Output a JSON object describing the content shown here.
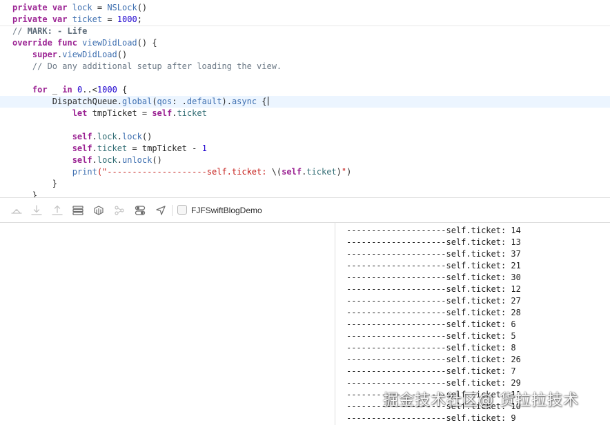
{
  "editor": {
    "lines": [
      [
        {
          "t": "private",
          "c": "kw"
        },
        {
          "t": " "
        },
        {
          "t": "var",
          "c": "kw"
        },
        {
          "t": " "
        },
        {
          "t": "lock",
          "c": "fn"
        },
        {
          "t": " = "
        },
        {
          "t": "NSLock",
          "c": "fn"
        },
        {
          "t": "()"
        }
      ],
      [
        {
          "t": "private",
          "c": "kw"
        },
        {
          "t": " "
        },
        {
          "t": "var",
          "c": "kw"
        },
        {
          "t": " "
        },
        {
          "t": "ticket",
          "c": "fn"
        },
        {
          "t": " = "
        },
        {
          "t": "1000",
          "c": "num"
        },
        {
          "t": ";"
        }
      ],
      [
        {
          "t": "// ",
          "c": "cm"
        },
        {
          "t": "MARK: - Life",
          "c": "cmb"
        }
      ],
      [
        {
          "t": "override",
          "c": "kw"
        },
        {
          "t": " "
        },
        {
          "t": "func",
          "c": "kw"
        },
        {
          "t": " "
        },
        {
          "t": "viewDidLoad",
          "c": "fn"
        },
        {
          "t": "() {"
        }
      ],
      [
        {
          "t": "    "
        },
        {
          "t": "super",
          "c": "kw"
        },
        {
          "t": "."
        },
        {
          "t": "viewDidLoad",
          "c": "fn"
        },
        {
          "t": "()"
        }
      ],
      [
        {
          "t": "    "
        },
        {
          "t": "// Do any additional setup after loading the view.",
          "c": "cm"
        }
      ],
      [],
      [
        {
          "t": "    "
        },
        {
          "t": "for",
          "c": "kw"
        },
        {
          "t": " _ "
        },
        {
          "t": "in",
          "c": "kw"
        },
        {
          "t": " "
        },
        {
          "t": "0",
          "c": "num"
        },
        {
          "t": "..<"
        },
        {
          "t": "1000",
          "c": "num"
        },
        {
          "t": " {"
        }
      ],
      [
        {
          "t": "        DispatchQueue."
        },
        {
          "t": "global",
          "c": "fn"
        },
        {
          "t": "("
        },
        {
          "t": "qos",
          "c": "fn"
        },
        {
          "t": ": ."
        },
        {
          "t": "default",
          "c": "fn"
        },
        {
          "t": ")."
        },
        {
          "t": "async",
          "c": "fn"
        },
        {
          "t": " {"
        },
        {
          "caret": true
        }
      ],
      [
        {
          "t": "            "
        },
        {
          "t": "let",
          "c": "kw"
        },
        {
          "t": " tmpTicket = "
        },
        {
          "t": "self",
          "c": "kw"
        },
        {
          "t": "."
        },
        {
          "t": "ticket",
          "c": "prop"
        }
      ],
      [],
      [
        {
          "t": "            "
        },
        {
          "t": "self",
          "c": "kw"
        },
        {
          "t": "."
        },
        {
          "t": "lock",
          "c": "prop"
        },
        {
          "t": "."
        },
        {
          "t": "lock",
          "c": "fn"
        },
        {
          "t": "()"
        }
      ],
      [
        {
          "t": "            "
        },
        {
          "t": "self",
          "c": "kw"
        },
        {
          "t": "."
        },
        {
          "t": "ticket",
          "c": "prop"
        },
        {
          "t": " = tmpTicket - "
        },
        {
          "t": "1",
          "c": "num"
        }
      ],
      [
        {
          "t": "            "
        },
        {
          "t": "self",
          "c": "kw"
        },
        {
          "t": "."
        },
        {
          "t": "lock",
          "c": "prop"
        },
        {
          "t": "."
        },
        {
          "t": "unlock",
          "c": "fn"
        },
        {
          "t": "()"
        }
      ],
      [
        {
          "t": "            "
        },
        {
          "t": "print",
          "c": "fn"
        },
        {
          "t": "(\"--------------------self.ticket: ",
          "c": "str"
        },
        {
          "t": "\\("
        },
        {
          "t": "self",
          "c": "kw"
        },
        {
          "t": "."
        },
        {
          "t": "ticket",
          "c": "prop"
        },
        {
          "t": ")"
        },
        {
          "t": "\"",
          "c": "str"
        },
        {
          "t": ")"
        }
      ],
      [
        {
          "t": "        }"
        }
      ],
      [
        {
          "t": "    }"
        }
      ]
    ],
    "current_line": 8
  },
  "debug_toolbar": {
    "icons": [
      "hide-debug-area-icon",
      "step-over-icon",
      "step-into-icon",
      "step-out-icon",
      "view-hierarchy-icon",
      "memory-graph-icon",
      "share-icon",
      "environment-overrides-icon",
      "simulate-location-icon"
    ],
    "process_name": "FJFSwiftBlogDemo"
  },
  "console": {
    "lines": [
      "--------------------self.ticket: 14",
      "--------------------self.ticket: 13",
      "--------------------self.ticket: 37",
      "--------------------self.ticket: 21",
      "--------------------self.ticket: 30",
      "--------------------self.ticket: 12",
      "--------------------self.ticket: 27",
      "--------------------self.ticket: 28",
      "--------------------self.ticket: 6",
      "--------------------self.ticket: 5",
      "--------------------self.ticket: 8",
      "--------------------self.ticket: 26",
      "--------------------self.ticket: 7",
      "--------------------self.ticket: 29",
      "--------------------self.ticket: 11",
      "--------------------self.ticket: 10",
      "--------------------self.ticket: 9"
    ]
  },
  "watermark": "掘金技术社区@ 货拉拉技术"
}
